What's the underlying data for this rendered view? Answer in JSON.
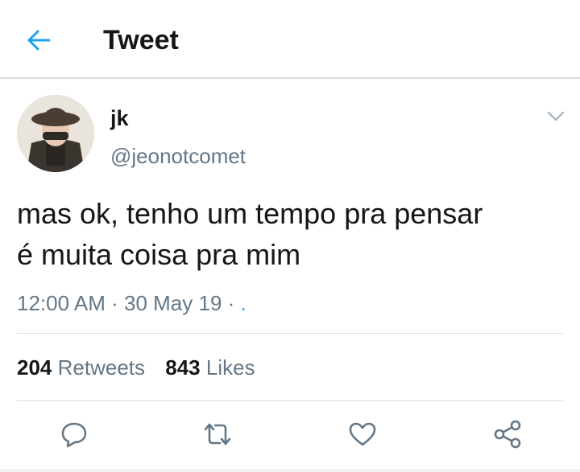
{
  "header": {
    "title": "Tweet",
    "back_icon": "arrow-left-icon",
    "accent_color": "#1da1f2"
  },
  "tweet": {
    "display_name": "jk",
    "handle": "@jeonotcomet",
    "text_lines": [
      "mas ok, tenho um tempo pra pensar",
      "é muita coisa pra mim"
    ],
    "time": "12:00 AM",
    "separator": "·",
    "date": "30 May 19",
    "trailing": "·",
    "trailing_link": "."
  },
  "stats": {
    "retweets_count": "204",
    "retweets_label": "Retweets",
    "likes_count": "843",
    "likes_label": "Likes"
  },
  "actions": [
    {
      "icon": "reply-icon"
    },
    {
      "icon": "retweet-icon"
    },
    {
      "icon": "heart-icon"
    },
    {
      "icon": "share-icon"
    }
  ]
}
